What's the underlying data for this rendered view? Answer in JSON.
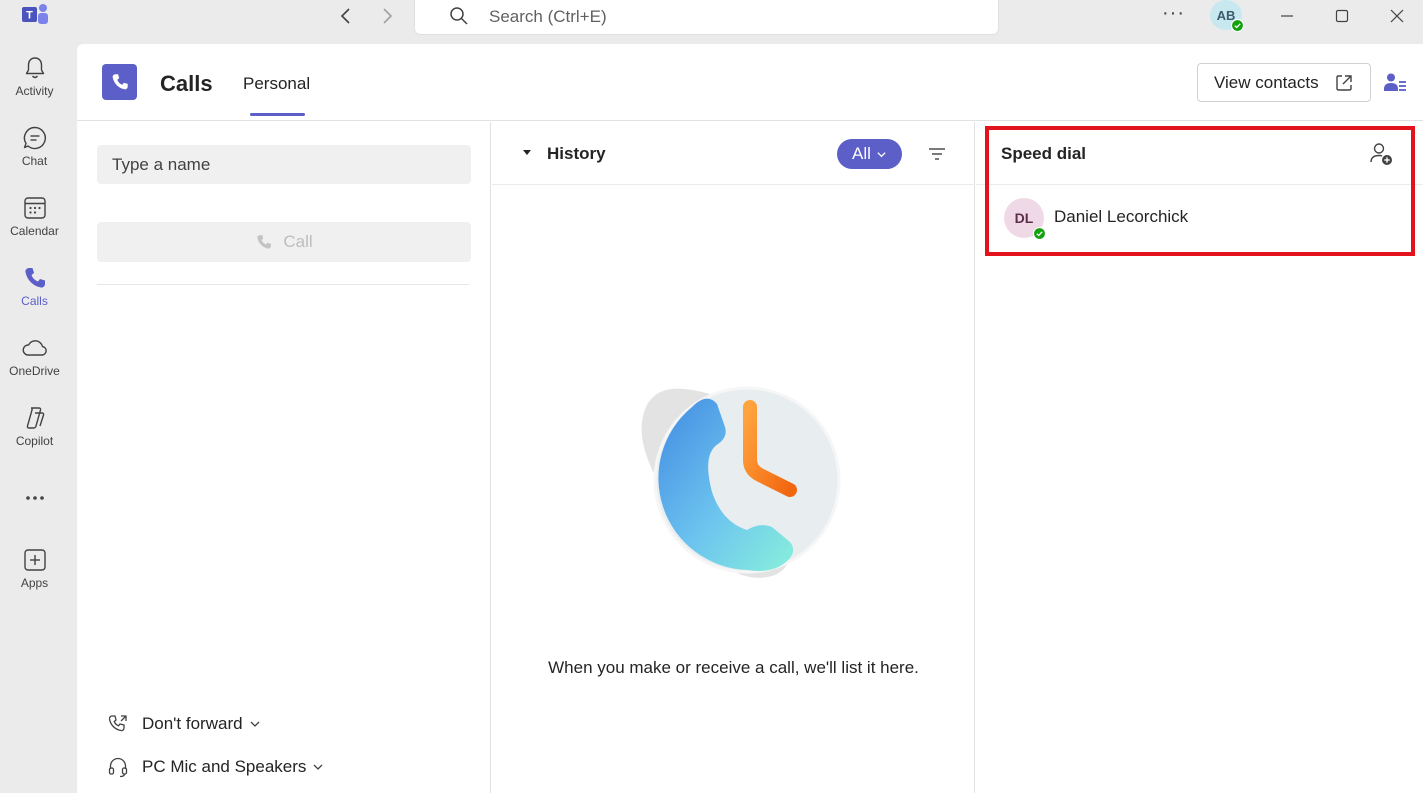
{
  "titlebar": {
    "search_placeholder": "Search (Ctrl+E)",
    "user_initials": "AB",
    "user_status": "available"
  },
  "rail": {
    "items": [
      {
        "label": "Activity",
        "icon": "bell-icon"
      },
      {
        "label": "Chat",
        "icon": "chat-icon"
      },
      {
        "label": "Calendar",
        "icon": "calendar-icon"
      },
      {
        "label": "Calls",
        "icon": "phone-icon",
        "active": true
      },
      {
        "label": "OneDrive",
        "icon": "cloud-icon"
      },
      {
        "label": "Copilot",
        "icon": "copilot-icon"
      },
      {
        "label": "",
        "icon": "more-icon"
      },
      {
        "label": "Apps",
        "icon": "add-app-icon"
      }
    ]
  },
  "header": {
    "title": "Calls",
    "tab": "Personal",
    "view_contacts_label": "View contacts"
  },
  "dial": {
    "input_placeholder": "Type a name",
    "call_label": "Call",
    "forward_label": "Don't forward",
    "device_label": "PC Mic and Speakers"
  },
  "history": {
    "title": "History",
    "filter_label": "All",
    "empty_message": "When you make or receive a call, we'll list it here."
  },
  "speed_dial": {
    "title": "Speed dial",
    "contacts": [
      {
        "initials": "DL",
        "name": "Daniel Lecorchick",
        "status": "available"
      }
    ]
  },
  "colors": {
    "accent": "#5b5fc7",
    "highlight": "#e3131e",
    "presence_available": "#13a10e"
  }
}
